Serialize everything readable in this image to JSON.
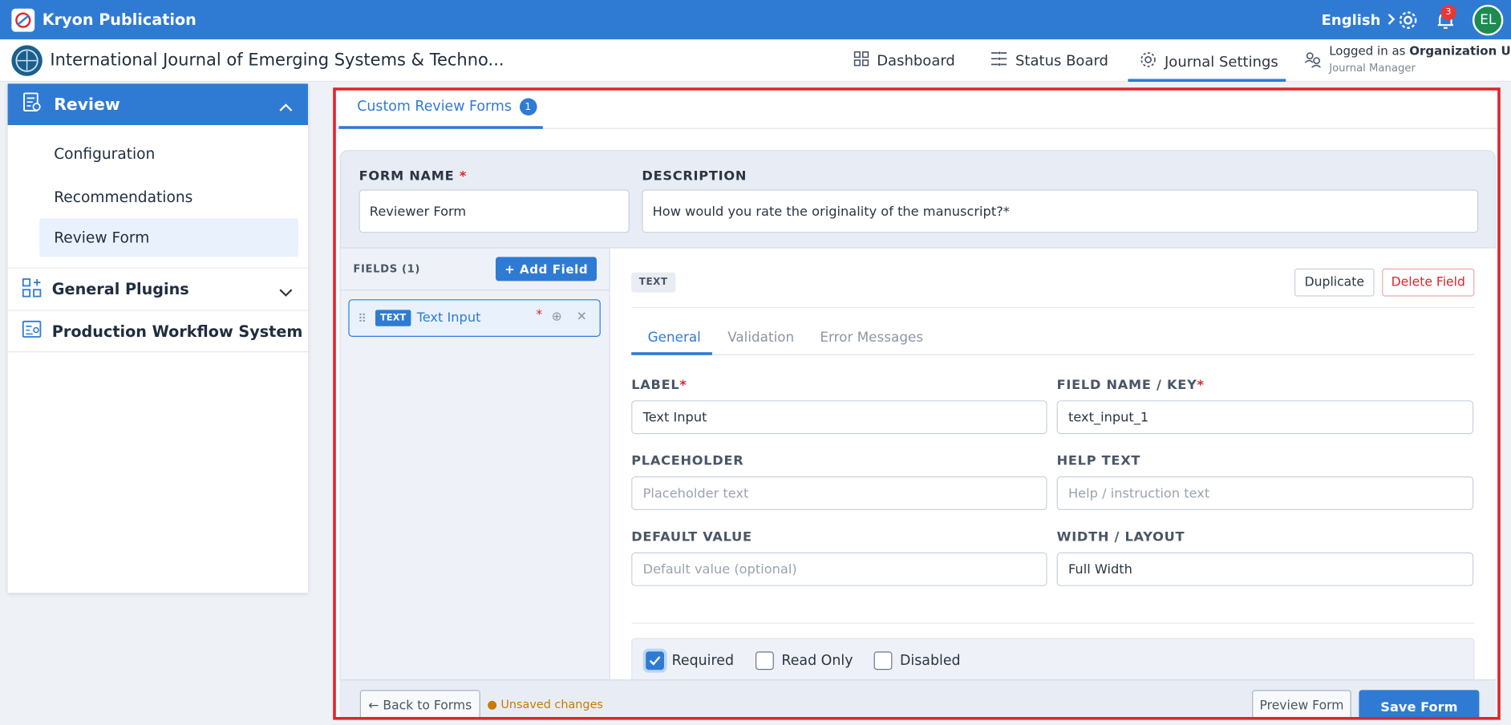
{
  "topbar": {
    "app_title": "Kryon Publication",
    "language": "English",
    "notification_count": "3",
    "avatar_initials": "EL"
  },
  "subbar": {
    "journal_title": "International Journal of Emerging Systems & Techno...",
    "nav": [
      {
        "label": "Dashboard",
        "icon": "grid-icon"
      },
      {
        "label": "Status Board",
        "icon": "status-board-icon"
      },
      {
        "label": "Journal Settings",
        "icon": "gear-icon",
        "active": true
      }
    ],
    "logged_in_prefix": "Logged in as",
    "logged_in_user": "Organization User",
    "role": "Journal Manager"
  },
  "sidebar": {
    "section_title": "Review",
    "items": [
      "Configuration",
      "Recommendations",
      "Review Form"
    ],
    "selected": "Review Form",
    "groups": [
      "General Plugins",
      "Production Workflow System"
    ]
  },
  "tabs": {
    "label": "Custom Review Forms",
    "count": "1"
  },
  "form": {
    "name_label": "FORM NAME",
    "name_value": "Reviewer Form",
    "description_label": "DESCRIPTION",
    "description_value": "How would you rate the originality of the manuscript?*"
  },
  "fields_pane": {
    "header": "FIELDS (1)",
    "add_label": "+ Add Field",
    "items": [
      {
        "tag": "TEXT",
        "label": "Text Input",
        "required_mark": "*"
      }
    ]
  },
  "editor": {
    "type_chip": "TEXT",
    "duplicate_label": "Duplicate",
    "delete_label": "Delete Field",
    "subtabs": [
      "General",
      "Validation",
      "Error Messages"
    ],
    "label_label": "LABEL",
    "label_value": "Text Input",
    "key_label": "FIELD NAME / KEY",
    "key_value": "text_input_1",
    "placeholder_label": "PLACEHOLDER",
    "placeholder_placeholder": "Placeholder text",
    "help_label": "HELP TEXT",
    "help_placeholder": "Help / instruction text",
    "default_label": "DEFAULT VALUE",
    "default_placeholder": "Default value (optional)",
    "width_label": "WIDTH / LAYOUT",
    "width_value": "Full Width",
    "checks": [
      {
        "label": "Required",
        "checked": true
      },
      {
        "label": "Read Only",
        "checked": false
      },
      {
        "label": "Disabled",
        "checked": false
      }
    ]
  },
  "footer": {
    "back_label": "← Back to Forms",
    "unsaved_label": "● Unsaved changes",
    "preview_label": "Preview Form",
    "save_label": "Save Form"
  },
  "colors": {
    "primary": "#2f7bd4",
    "danger": "#e0242c",
    "highlight_frame": "#e0242c",
    "avatar_bg": "#1d8a52",
    "warning_text": "#c97a00"
  }
}
